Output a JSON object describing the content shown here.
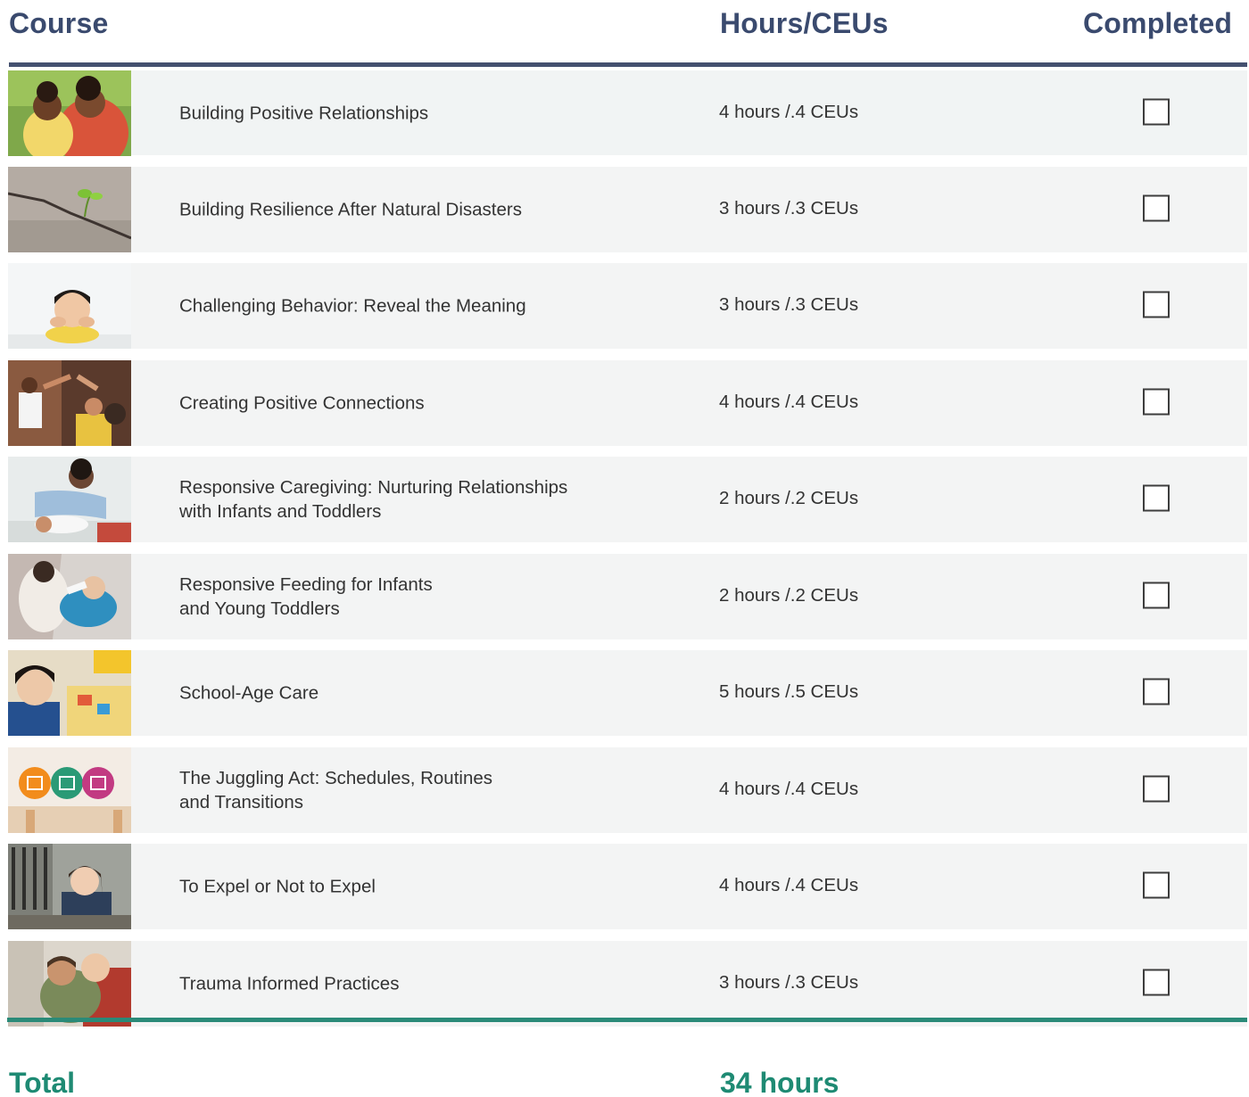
{
  "header": {
    "course": "Course",
    "hours": "Hours/CEUs",
    "completed": "Completed"
  },
  "courses": [
    {
      "title": "Building Positive Relationships",
      "hours": "4 hours /.4 CEUs",
      "completed": false,
      "image": "mother-and-child-photo"
    },
    {
      "title": "Building Resilience After Natural Disasters",
      "hours": "3 hours /.3 CEUs",
      "completed": false,
      "image": "sprout-in-cracked-ground-photo"
    },
    {
      "title": "Challenging Behavior: Reveal the Meaning",
      "hours": "3 hours /.3 CEUs",
      "completed": false,
      "image": "pouting-child-photo"
    },
    {
      "title": "Creating Positive Connections",
      "hours": "4 hours /.4 CEUs",
      "completed": false,
      "image": "children-high-five-photo"
    },
    {
      "title": "Responsive Caregiving: Nurturing Relationships\nwith Infants and Toddlers",
      "hours": "2 hours /.2 CEUs",
      "completed": false,
      "image": "caregiver-with-infant-photo"
    },
    {
      "title": "Responsive Feeding for Infants\nand Young Toddlers",
      "hours": "2 hours /.2 CEUs",
      "completed": false,
      "image": "bottle-feeding-infant-photo"
    },
    {
      "title": "School-Age Care",
      "hours": "5 hours /.5 CEUs",
      "completed": false,
      "image": "smiling-school-age-child-photo"
    },
    {
      "title": "The Juggling Act: Schedules, Routines\nand Transitions",
      "hours": "4 hours /.4 CEUs",
      "completed": false,
      "image": "calendar-icons-graphic"
    },
    {
      "title": "To Expel or Not to Expel",
      "hours": "4 hours /.4 CEUs",
      "completed": false,
      "image": "child-behind-fence-photo"
    },
    {
      "title": "Trauma Informed Practices",
      "hours": "3 hours /.3 CEUs",
      "completed": false,
      "image": "adult-hugging-child-photo"
    }
  ],
  "total": {
    "label": "Total",
    "hours": "34 hours"
  },
  "colors": {
    "header_text": "#3a4a6e",
    "header_rule": "#44506f",
    "total_text": "#1e8a73",
    "bottom_rule": "#2a8a78",
    "row_bg": "#f3f4f4"
  }
}
